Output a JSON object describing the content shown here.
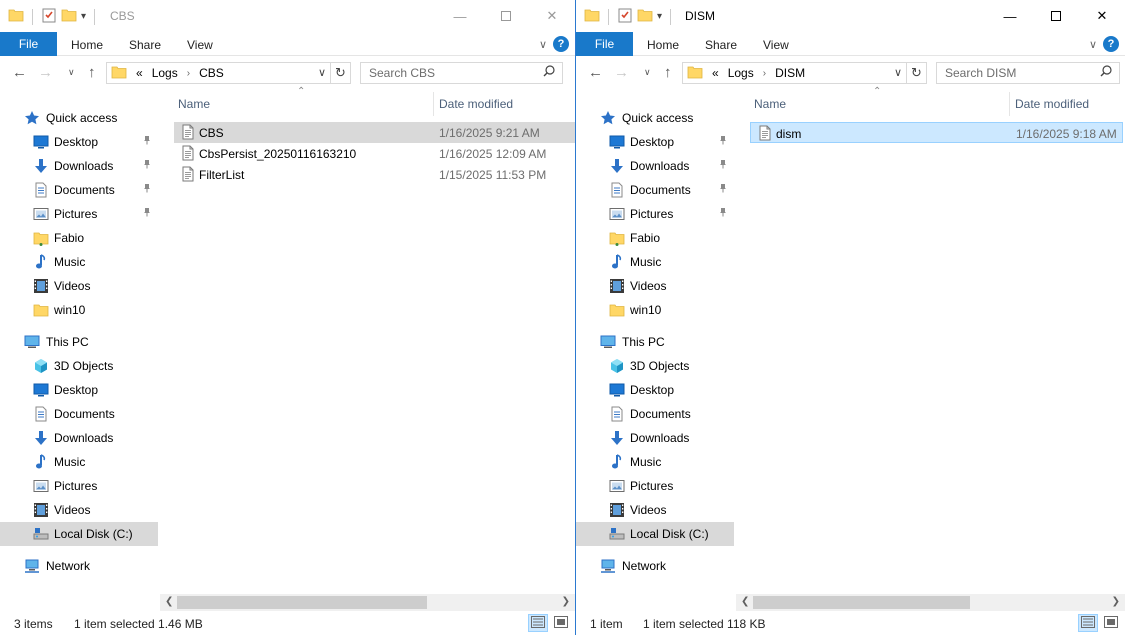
{
  "left": {
    "title": "CBS",
    "ribbon": {
      "file": "File",
      "home": "Home",
      "share": "Share",
      "view": "View"
    },
    "address": {
      "overflow": "«",
      "crumbs": [
        "Logs",
        "CBS"
      ]
    },
    "search_placeholder": "Search CBS",
    "columns": {
      "name": "Name",
      "date": "Date modified"
    },
    "files": [
      {
        "name": "CBS",
        "date": "1/16/2025 9:21 AM",
        "selected": true
      },
      {
        "name": "CbsPersist_20250116163210",
        "date": "1/16/2025 12:09 AM",
        "selected": false
      },
      {
        "name": "FilterList",
        "date": "1/15/2025 11:53 PM",
        "selected": false
      }
    ],
    "status": {
      "count": "3 items",
      "selection": "1 item selected  1.46 MB"
    }
  },
  "right": {
    "title": "DISM",
    "ribbon": {
      "file": "File",
      "home": "Home",
      "share": "Share",
      "view": "View"
    },
    "address": {
      "overflow": "«",
      "crumbs": [
        "Logs",
        "DISM"
      ]
    },
    "search_placeholder": "Search DISM",
    "columns": {
      "name": "Name",
      "date": "Date modified"
    },
    "files": [
      {
        "name": "dism",
        "date": "1/16/2025 9:18 AM",
        "selected": true
      }
    ],
    "status": {
      "count": "1 item",
      "selection": "1 item selected  118 KB"
    }
  },
  "nav": {
    "quick_access": "Quick access",
    "quick_items": [
      {
        "label": "Desktop",
        "icon": "desktop-icon",
        "pinned": true
      },
      {
        "label": "Downloads",
        "icon": "downloads-icon",
        "pinned": true
      },
      {
        "label": "Documents",
        "icon": "documents-icon",
        "pinned": true
      },
      {
        "label": "Pictures",
        "icon": "pictures-icon",
        "pinned": true
      },
      {
        "label": "Fabio",
        "icon": "user-folder-icon",
        "pinned": false
      },
      {
        "label": "Music",
        "icon": "music-icon",
        "pinned": false
      },
      {
        "label": "Videos",
        "icon": "videos-icon",
        "pinned": false
      },
      {
        "label": "win10",
        "icon": "folder-icon",
        "pinned": false
      }
    ],
    "this_pc": "This PC",
    "pc_items": [
      {
        "label": "3D Objects",
        "icon": "3d-objects-icon"
      },
      {
        "label": "Desktop",
        "icon": "desktop-icon"
      },
      {
        "label": "Documents",
        "icon": "documents-icon"
      },
      {
        "label": "Downloads",
        "icon": "downloads-icon"
      },
      {
        "label": "Music",
        "icon": "music-icon"
      },
      {
        "label": "Pictures",
        "icon": "pictures-icon"
      },
      {
        "label": "Videos",
        "icon": "videos-icon"
      },
      {
        "label": "Local Disk (C:)",
        "icon": "local-disk-icon",
        "selected": true
      }
    ],
    "network": "Network"
  },
  "colors": {
    "accent": "#1979ca",
    "selection_blue": "#cce8ff",
    "selection_grey": "#d9d9d9"
  }
}
